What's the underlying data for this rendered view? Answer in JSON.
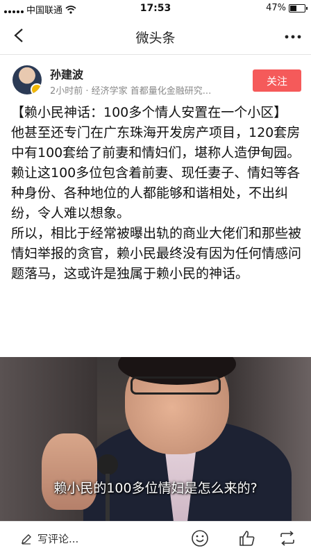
{
  "status_bar": {
    "carrier": "中国联通",
    "time": "17:53",
    "battery": "47%",
    "battery_level": 0.47
  },
  "nav": {
    "title": "微头条"
  },
  "author": {
    "name": "孙建波",
    "meta": "2小时前 · 经济学家 首都量化金融研究...",
    "follow_label": "关注"
  },
  "article": {
    "paragraphs": [
      "【赖小民神话：100多个情人安置在一个小区】",
      "他甚至还专门在广东珠海开发房产项目，120套房中有100套给了前妻和情妇们，堪称人造伊甸园。",
      "赖让这100多位包含着前妻、现任妻子、情妇等各种身份、各种地位的人都能够和谐相处，不出纠纷，令人难以想象。",
      "所以，相比于经常被曝出轨的商业大佬们和那些被情妇举报的贪官，赖小民最终没有因为任何情感问题落马，这或许是独属于赖小民的神话。"
    ]
  },
  "photo": {
    "caption": "赖小民的100多位情妇是怎么来的?"
  },
  "bottom_bar": {
    "comment_placeholder": "写评论..."
  },
  "colors": {
    "follow_button": "#f55a5a",
    "divider": "#e3e3e3"
  }
}
